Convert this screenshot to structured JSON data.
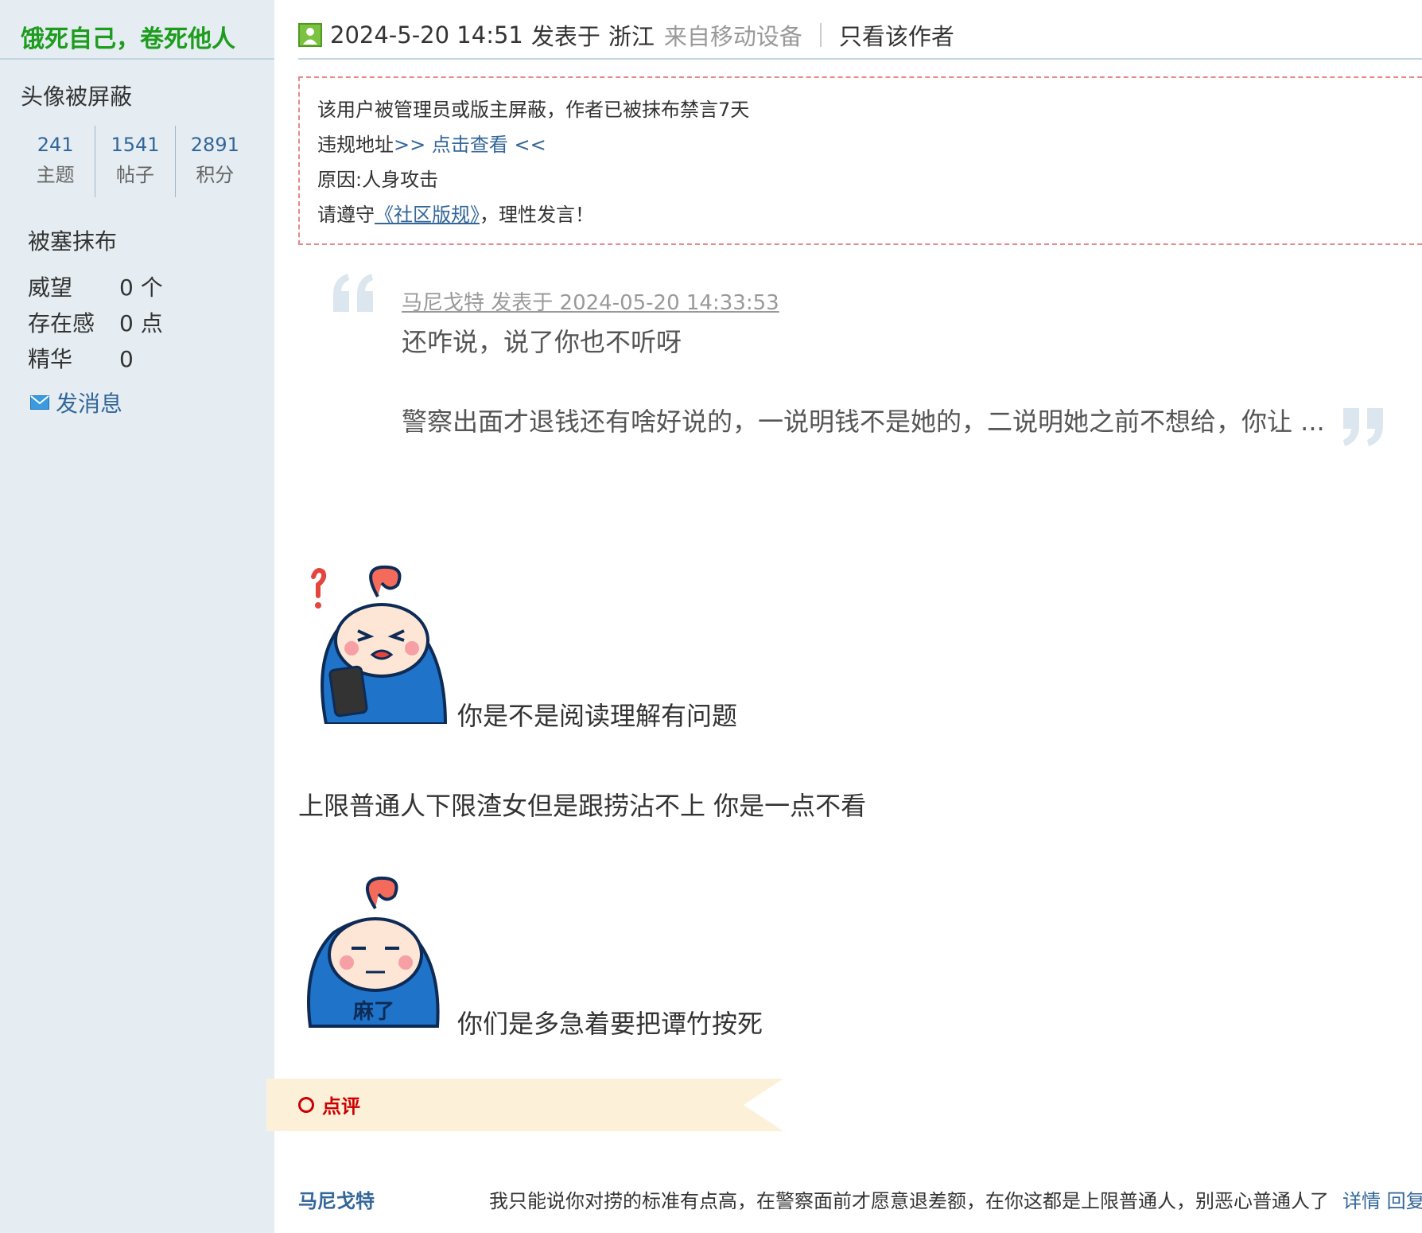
{
  "sidebar": {
    "username": "饿死自己，卷死他人",
    "avatar_status": "头像被屏蔽",
    "stats": [
      {
        "value": "241",
        "label": "主题"
      },
      {
        "value": "1541",
        "label": "帖子"
      },
      {
        "value": "2891",
        "label": "积分"
      }
    ],
    "group": "被塞抹布",
    "details": [
      {
        "label": "威望",
        "value": "0 个"
      },
      {
        "label": "存在感",
        "value": "0 点"
      },
      {
        "label": "精华",
        "value": "0"
      }
    ],
    "send_message": "发消息"
  },
  "post_meta": {
    "datetime": "2024-5-20 14:51",
    "posted_at": "发表于",
    "location": "浙江",
    "device": "来自移动设备",
    "only_author": "只看该作者"
  },
  "notice": {
    "line1": "该用户被管理员或版主屏蔽，作者已被抹布禁言7天",
    "line2_prefix": "违规地址",
    "line2_link": ">> 点击查看 <<",
    "line3": "原因:人身攻击",
    "line4_prefix": "请遵守",
    "line4_link": "《社区版规》",
    "line4_suffix": "，理性发言！"
  },
  "quote": {
    "source": "马尼戈特 发表于 2024-05-20 14:33:53",
    "line1": "还咋说，说了你也不听呀",
    "line2": "警察出面才退钱还有啥好说的，一说明钱不是她的，二说明她之前不想给，你让 ..."
  },
  "body": {
    "text1": "你是不是阅读理解有问题",
    "text2": "上限普通人下限渣女但是跟捞沾不上    你是一点不看",
    "sticker2_caption": "麻了",
    "text3": "你们是多急着要把谭竹按死"
  },
  "review": {
    "label": "点评",
    "comments": [
      {
        "user": "马尼戈特",
        "text": "我只能说你对捞的标准有点高，在警察面前才愿意退差额，在你这都是上限普通人，别恶心普通人了",
        "actions": "详情 回复"
      }
    ]
  },
  "colors": {
    "sidebar_bg": "#e5edf2",
    "username": "#1d9c1d",
    "link": "#336699",
    "notice_border": "#e58a8a",
    "review_bg": "#fdf0d9",
    "review_label": "#cc0000"
  },
  "icons": [
    "online-status-icon",
    "mail-icon",
    "quote-open-icon",
    "quote-close-icon",
    "review-circle-icon"
  ]
}
